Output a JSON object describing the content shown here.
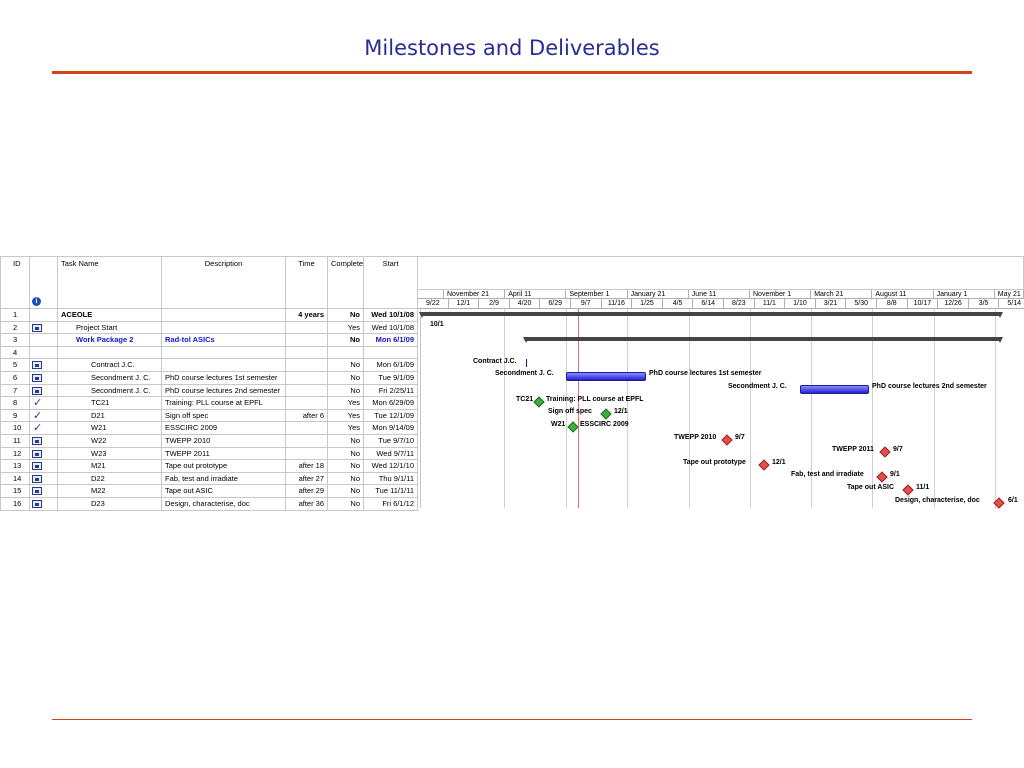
{
  "page": {
    "title": "Milestones and Deliverables"
  },
  "table": {
    "headers": {
      "id": "ID",
      "task": "Task Name",
      "desc": "Description",
      "time": "Time",
      "complete": "Complete",
      "start": "Start"
    },
    "rows": [
      {
        "id": "1",
        "task": "ACEOLE",
        "desc": "",
        "time": "4 years",
        "complete": "No",
        "start": "Wed 10/1/08",
        "style": "bold",
        "indicator": ""
      },
      {
        "id": "2",
        "task": "Project Start",
        "desc": "",
        "time": "",
        "complete": "Yes",
        "start": "Wed 10/1/08",
        "style": "",
        "indicator": "calendar-icon"
      },
      {
        "id": "3",
        "task": "Work Package 2",
        "desc": "Rad-tol ASICs",
        "time": "",
        "complete": "No",
        "start": "Mon 6/1/09",
        "style": "blue",
        "indicator": ""
      },
      {
        "id": "4",
        "task": "",
        "desc": "",
        "time": "",
        "complete": "",
        "start": "",
        "style": "",
        "indicator": ""
      },
      {
        "id": "5",
        "task": "Contract J.C.",
        "desc": "",
        "time": "",
        "complete": "No",
        "start": "Mon 6/1/09",
        "style": "",
        "indicator": "calendar-icon"
      },
      {
        "id": "6",
        "task": "Secondment J. C.",
        "desc": "PhD course lectures 1st semester",
        "time": "",
        "complete": "No",
        "start": "Tue 9/1/09",
        "style": "",
        "indicator": "calendar-icon"
      },
      {
        "id": "7",
        "task": "Secondment J. C.",
        "desc": "PhD course lectures 2nd semester",
        "time": "",
        "complete": "No",
        "start": "Fri 2/25/11",
        "style": "",
        "indicator": "calendar-icon"
      },
      {
        "id": "8",
        "task": "TC21",
        "desc": "Training: PLL course at EPFL",
        "time": "",
        "complete": "Yes",
        "start": "Mon 6/29/09",
        "style": "",
        "indicator": "check-icon"
      },
      {
        "id": "9",
        "task": "D21",
        "desc": "Sign off spec",
        "time": "after 6",
        "complete": "Yes",
        "start": "Tue 12/1/09",
        "style": "",
        "indicator": "check-icon"
      },
      {
        "id": "10",
        "task": "W21",
        "desc": "ESSCIRC 2009",
        "time": "",
        "complete": "Yes",
        "start": "Mon 9/14/09",
        "style": "",
        "indicator": "check-icon"
      },
      {
        "id": "11",
        "task": "W22",
        "desc": "TWEPP 2010",
        "time": "",
        "complete": "No",
        "start": "Tue 9/7/10",
        "style": "",
        "indicator": "calendar-icon"
      },
      {
        "id": "12",
        "task": "W23",
        "desc": "TWEPP 2011",
        "time": "",
        "complete": "No",
        "start": "Wed 9/7/11",
        "style": "",
        "indicator": "calendar-icon"
      },
      {
        "id": "13",
        "task": "M21",
        "desc": "Tape out prototype",
        "time": "after 18",
        "complete": "No",
        "start": "Wed 12/1/10",
        "style": "",
        "indicator": "calendar-icon"
      },
      {
        "id": "14",
        "task": "D22",
        "desc": "Fab, test and irradiate",
        "time": "after 27",
        "complete": "No",
        "start": "Thu 9/1/11",
        "style": "",
        "indicator": "calendar-icon"
      },
      {
        "id": "15",
        "task": "M22",
        "desc": "Tape out ASIC",
        "time": "after 29",
        "complete": "No",
        "start": "Tue 11/1/11",
        "style": "",
        "indicator": "calendar-icon"
      },
      {
        "id": "16",
        "task": "D23",
        "desc": "Design, characterise, doc",
        "time": "after 36",
        "complete": "No",
        "start": "Fri 6/1/12",
        "style": "",
        "indicator": "calendar-icon"
      }
    ]
  },
  "timeline": {
    "top": [
      "November 21",
      "April 11",
      "September 1",
      "January 21",
      "June 11",
      "November 1",
      "March 21",
      "August 11",
      "January 1",
      "May 21"
    ],
    "bottom": [
      "9/22",
      "12/1",
      "2/9",
      "4/20",
      "6/29",
      "9/7",
      "11/16",
      "1/25",
      "4/5",
      "6/14",
      "8/23",
      "11/1",
      "1/10",
      "3/21",
      "5/30",
      "8/8",
      "10/17",
      "12/26",
      "3/5",
      "5/14"
    ]
  },
  "bars": {
    "labels": {
      "r2": "10/1",
      "r5": "Contract J.C.",
      "r6a": "Secondment J. C.",
      "r6b": "PhD course lectures 1st semester",
      "r7a": "Secondment J. C.",
      "r7b": "PhD course lectures 2nd semester",
      "r8a": "TC21",
      "r8b": "Training: PLL course at EPFL",
      "r9a": "Sign off spec",
      "r9b": "12/1",
      "r10a": "W21",
      "r10b": "ESSCIRC 2009",
      "r11a": "TWEPP 2010",
      "r11b": "9/7",
      "r12a": "TWEPP 2011",
      "r12b": "9/7",
      "r13a": "Tape out prototype",
      "r13b": "12/1",
      "r14a": "Fab, test and irradiate",
      "r14b": "9/1",
      "r15a": "Tape out ASIC",
      "r15b": "11/1",
      "r16a": "Design, characterise, doc",
      "r16b": "6/1"
    }
  }
}
